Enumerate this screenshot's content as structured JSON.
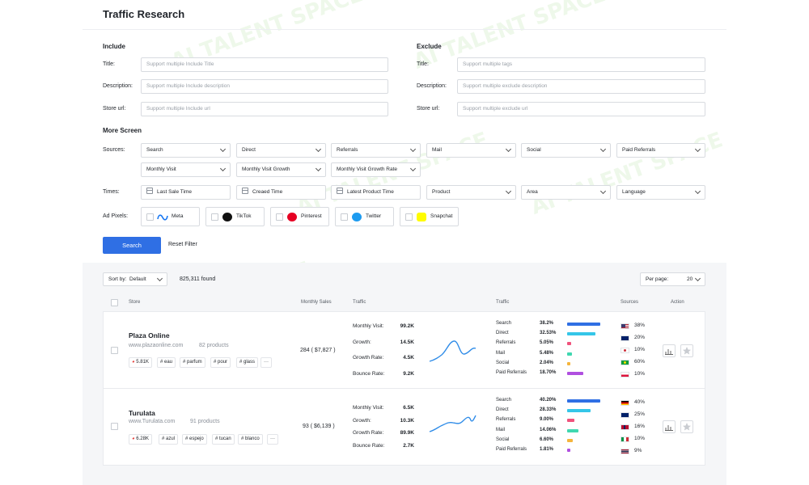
{
  "page_title": "Traffic Research",
  "include": {
    "heading": "Include",
    "title_label": "Title:",
    "title_placeholder": "Support multiple Include Title",
    "desc_label": "Description:",
    "desc_placeholder": "Support multiple Include description",
    "url_label": "Store url:",
    "url_placeholder": "Support multiple Include url"
  },
  "exclude": {
    "heading": "Exclude",
    "title_label": "Title:",
    "title_placeholder": "Support multiple tags",
    "desc_label": "Description:",
    "desc_placeholder": "Support multiple exclude description",
    "url_label": "Store url:",
    "url_placeholder": "Support multiple exclude url"
  },
  "more_screen": {
    "heading": "More Screen",
    "sources_label": "Sources:",
    "sources": [
      "Search",
      "Direct",
      "Referrals",
      "Mail",
      "Social",
      "Paid Referrals"
    ],
    "visit_filters": [
      "Monthly Visit",
      "Monthly Visit Growth",
      "Monthly Visit Growth Rate"
    ],
    "times_label": "Times:",
    "times": [
      "Last Sale Time",
      "Creaed Time",
      "Latest Product Time"
    ],
    "time_selects": [
      "Product",
      "Area",
      "Language"
    ],
    "pixels_label": "Ad Pixels:",
    "pixels": [
      "Meta",
      "TikTok",
      "Pinterest",
      "Twitter",
      "Snapchat"
    ]
  },
  "actions": {
    "search": "Search",
    "reset": "Reset Filter"
  },
  "toolbar": {
    "sort_label": "Sort by:",
    "sort_value": "Default",
    "found": "825,311 found",
    "per_page_label": "Per page:",
    "per_page_value": "20"
  },
  "table_headers": {
    "store": "Store",
    "monthly_sales": "Monthly Sales",
    "traffic": "Traffic",
    "traffic2": "Traffic",
    "sources": "Sources",
    "action": "Action"
  },
  "rows": [
    {
      "name": "Plaza Online",
      "url": "www.plazaonline.com",
      "products": "82 products",
      "followers": "5.81K",
      "tags": [
        "# eau",
        "# parfum",
        "# pour",
        "# glass",
        "···"
      ],
      "sales": "284  ( $7,827 )",
      "traffic": [
        {
          "label": "Monthly Visit:",
          "value": "99.2K"
        },
        {
          "label": "Growth:",
          "value": "14.5K"
        },
        {
          "label": "Growth Rate:",
          "value": "4.5K"
        },
        {
          "label": "Bounce Rate:",
          "value": "9.2K"
        }
      ],
      "sources": [
        {
          "label": "Search",
          "pct": "38.2%",
          "share": 0.382
        },
        {
          "label": "Direct",
          "pct": "32.53%",
          "share": 0.3253
        },
        {
          "label": "Referrals",
          "pct": "5.05%",
          "share": 0.0505
        },
        {
          "label": "Mail",
          "pct": "5.48%",
          "share": 0.0548
        },
        {
          "label": "Social",
          "pct": "2.04%",
          "share": 0.0204
        },
        {
          "label": "Paid Referrals",
          "pct": "18.70%",
          "share": 0.187
        }
      ],
      "countries": [
        "38%",
        "20%",
        "10%",
        "60%",
        "10%"
      ]
    },
    {
      "name": "Turulata",
      "url": "www.Turulata.com",
      "products": "91 products",
      "followers": "6.28K",
      "tags": [
        "# azul",
        "# espejo",
        "# tucan",
        "# blanco",
        "···"
      ],
      "sales": "93  ( $6,139 )",
      "traffic": [
        {
          "label": "Monthly Visit:",
          "value": "6.5K"
        },
        {
          "label": "Growth:",
          "value": "10.3K"
        },
        {
          "label": "Growth Rate:",
          "value": "89.9K"
        },
        {
          "label": "Bounce Rate:",
          "value": "2.7K"
        }
      ],
      "sources": [
        {
          "label": "Search",
          "pct": "40.20%",
          "share": 0.402
        },
        {
          "label": "Direct",
          "pct": "28.33%",
          "share": 0.2833
        },
        {
          "label": "Referrals",
          "pct": "9.00%",
          "share": 0.09
        },
        {
          "label": "Mail",
          "pct": "14.06%",
          "share": 0.1406
        },
        {
          "label": "Social",
          "pct": "6.60%",
          "share": 0.066
        },
        {
          "label": "Paid Referrals",
          "pct": "1.81%",
          "share": 0.0181
        }
      ],
      "countries": [
        "40%",
        "25%",
        "16%",
        "10%",
        "9%"
      ]
    }
  ],
  "colors": {
    "accent": "#2f6fe4",
    "bars": [
      "#2f6fe4",
      "#35c6e8",
      "#f0527c",
      "#3fd7b0",
      "#f5b53c",
      "#b04fe0"
    ]
  }
}
